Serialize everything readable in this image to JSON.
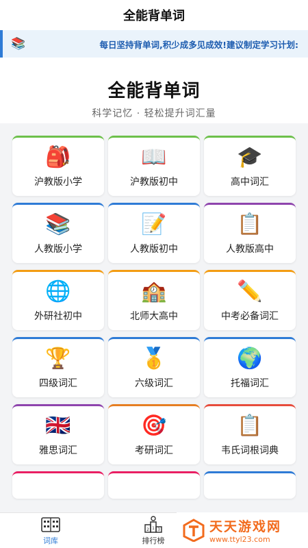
{
  "header": {
    "title": "全能背单词"
  },
  "notice": {
    "icon": "books-icon",
    "text": "每日坚持背单词,积少成多见成效!建议制定学习计划:"
  },
  "hero": {
    "title": "全能背单词",
    "subtitle": "科学记忆 · 轻松提升词汇量"
  },
  "cards": [
    {
      "label": "沪教版小学",
      "emoji": "🎒",
      "color": "#6cc04a"
    },
    {
      "label": "沪教版初中",
      "emoji": "📖",
      "color": "#6cc04a"
    },
    {
      "label": "高中词汇",
      "emoji": "🎓",
      "color": "#6cc04a"
    },
    {
      "label": "人教版小学",
      "emoji": "📚",
      "color": "#2e7bd6"
    },
    {
      "label": "人教版初中",
      "emoji": "📝",
      "color": "#2e7bd6"
    },
    {
      "label": "人教版高中",
      "emoji": "📋",
      "color": "#8e44ad"
    },
    {
      "label": "外研社初中",
      "emoji": "🌐",
      "color": "#f39c12"
    },
    {
      "label": "北师大高中",
      "emoji": "🏫",
      "color": "#f39c12"
    },
    {
      "label": "中考必备词汇",
      "emoji": "✏️",
      "color": "#f39c12"
    },
    {
      "label": "四级词汇",
      "emoji": "🏆",
      "color": "#2e7bd6"
    },
    {
      "label": "六级词汇",
      "emoji": "🥇",
      "color": "#2e7bd6"
    },
    {
      "label": "托福词汇",
      "emoji": "🌍",
      "color": "#2e7bd6"
    },
    {
      "label": "雅思词汇",
      "emoji": "🇬🇧",
      "color": "#8e44ad"
    },
    {
      "label": "考研词汇",
      "emoji": "🎯",
      "color": "#e67e22"
    },
    {
      "label": "韦氏词根词典",
      "emoji": "📋",
      "color": "#e74c3c"
    }
  ],
  "partial_cards": [
    {
      "color": "#e91e63"
    },
    {
      "color": "#e91e63"
    },
    {
      "color": "#2e7bd6"
    }
  ],
  "tabbar": {
    "tabs": [
      {
        "label": "词库",
        "icon": "vocabulary-icon",
        "active": true
      },
      {
        "label": "排行榜",
        "icon": "leaderboard-icon",
        "active": false
      }
    ]
  },
  "watermark": {
    "title": "天天游戏网",
    "url": "www.ttyl23.com",
    "icon": "site-logo-icon"
  }
}
